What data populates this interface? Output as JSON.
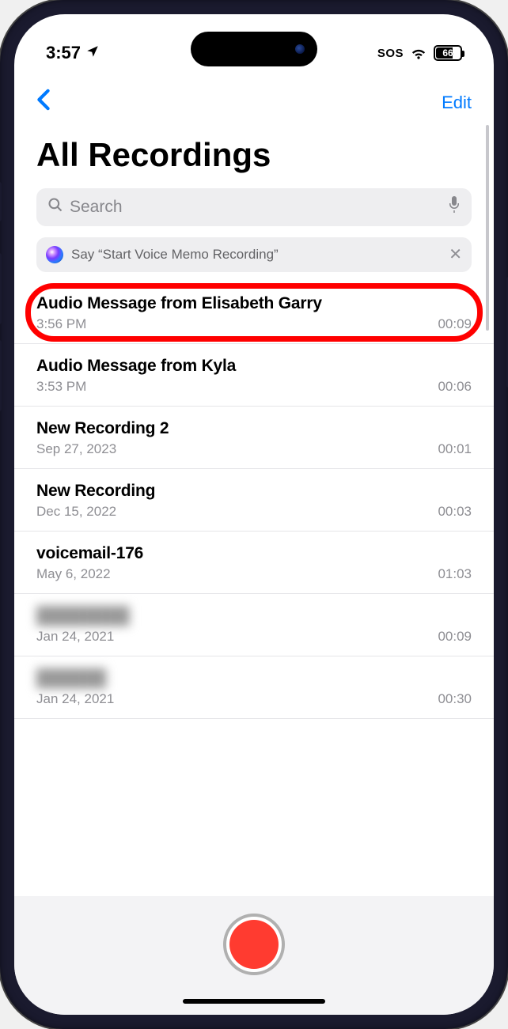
{
  "status": {
    "time": "3:57",
    "sos": "SOS",
    "battery": "66"
  },
  "nav": {
    "edit": "Edit"
  },
  "title": "All Recordings",
  "search": {
    "placeholder": "Search"
  },
  "siri": {
    "text": "Say “Start Voice Memo Recording”"
  },
  "recordings": [
    {
      "title": "Audio Message from Elisabeth Garry",
      "sub": "3:56 PM",
      "dur": "00:09",
      "highlight": true
    },
    {
      "title": "Audio Message from Kyla",
      "sub": "3:53 PM",
      "dur": "00:06"
    },
    {
      "title": "New Recording 2",
      "sub": "Sep 27, 2023",
      "dur": "00:01"
    },
    {
      "title": "New Recording",
      "sub": "Dec 15, 2022",
      "dur": "00:03"
    },
    {
      "title": "voicemail-176",
      "sub": "May 6, 2022",
      "dur": "01:03"
    },
    {
      "title": "████████",
      "sub": "Jan 24, 2021",
      "dur": "00:09",
      "blurred": true
    },
    {
      "title": "██████",
      "sub": "Jan 24, 2021",
      "dur": "00:30",
      "blurred": true
    }
  ]
}
